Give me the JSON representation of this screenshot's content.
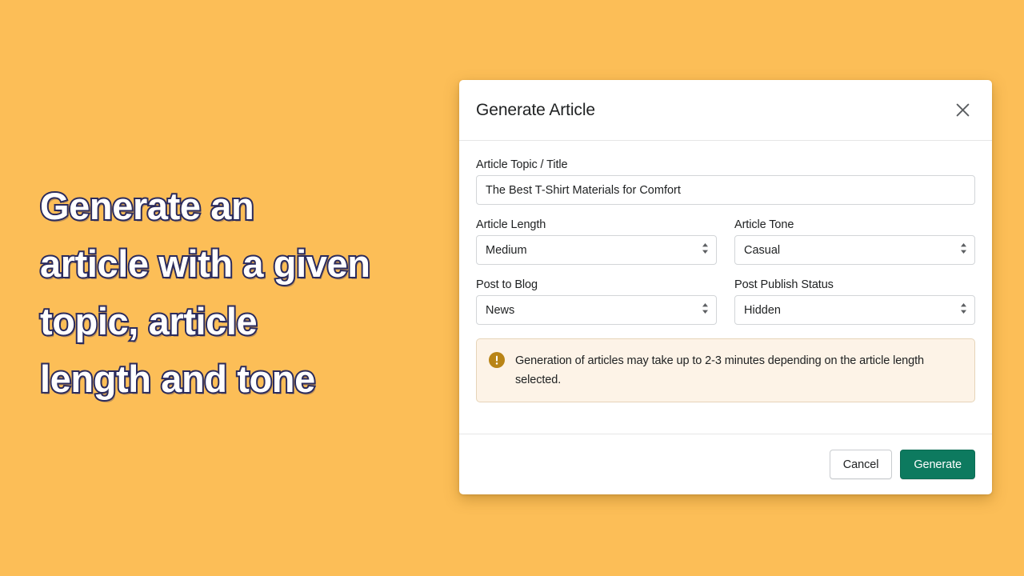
{
  "page": {
    "background_color": "#fcbe57",
    "promo_heading": "Generate an\narticle with a given\ntopic, article\nlength and tone",
    "promo_text_color": "#ffffff",
    "promo_outline_color": "#2b2b5c"
  },
  "modal": {
    "title": "Generate Article",
    "close_icon": "close-icon",
    "fields": {
      "topic": {
        "label": "Article Topic / Title",
        "value": "The Best T-Shirt Materials for Comfort",
        "placeholder": ""
      },
      "length": {
        "label": "Article Length",
        "value": "Medium"
      },
      "tone": {
        "label": "Article Tone",
        "value": "Casual"
      },
      "blog": {
        "label": "Post to Blog",
        "value": "News"
      },
      "publish_status": {
        "label": "Post Publish Status",
        "value": "Hidden"
      }
    },
    "notice": {
      "icon": "alert-circle-icon",
      "icon_color": "#b98416",
      "background_color": "#fdf3e7",
      "border_color": "#e6d4b8",
      "text": "Generation of articles may take up to 2-3 minutes depending on the article length selected."
    },
    "footer": {
      "cancel_label": "Cancel",
      "generate_label": "Generate",
      "generate_color": "#0d7a5f"
    }
  }
}
